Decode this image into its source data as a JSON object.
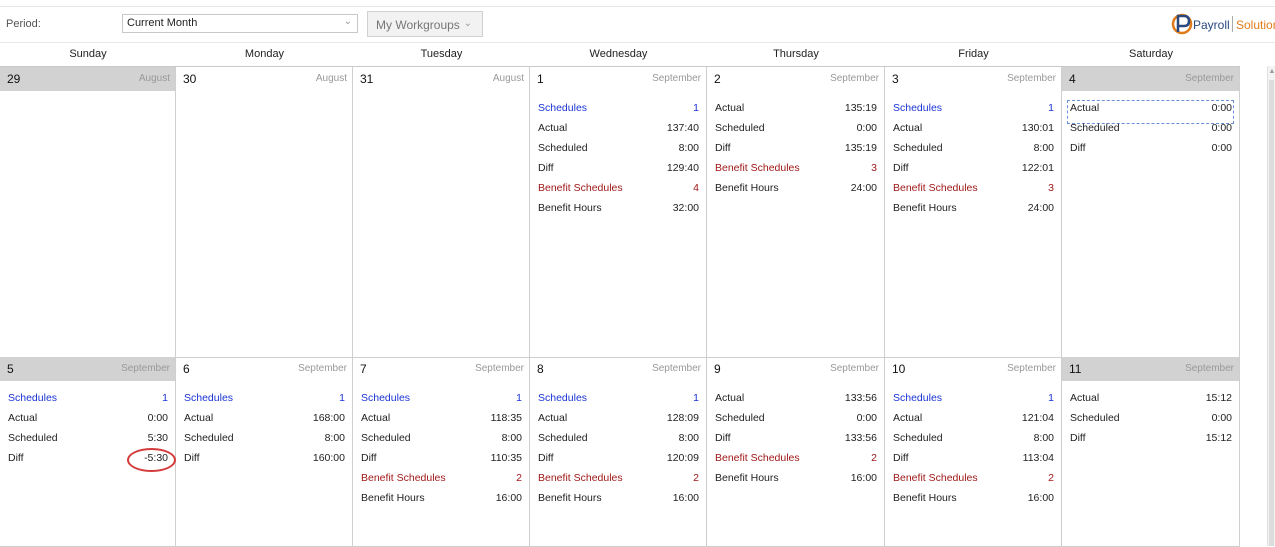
{
  "toolbar": {
    "period_label": "Period:",
    "period_value": "Current Month",
    "workgroups_label": "My Workgroups",
    "logo_text_a": "Payroll",
    "logo_text_b": "Solutions"
  },
  "weekdays": [
    "Sunday",
    "Monday",
    "Tuesday",
    "Wednesday",
    "Thursday",
    "Friday",
    "Saturday"
  ],
  "weeks": [
    {
      "days": [
        {
          "day": "29",
          "month": "August",
          "rows": []
        },
        {
          "day": "30",
          "month": "August",
          "rows": []
        },
        {
          "day": "31",
          "month": "August",
          "rows": []
        },
        {
          "day": "1",
          "month": "September",
          "rows": [
            {
              "label": "Schedules",
              "value": "1",
              "style": "blue"
            },
            {
              "label": "Actual",
              "value": "137:40"
            },
            {
              "label": "Scheduled",
              "value": "8:00"
            },
            {
              "label": "Diff",
              "value": "129:40"
            },
            {
              "label": "Benefit Schedules",
              "value": "4",
              "style": "red"
            },
            {
              "label": "Benefit Hours",
              "value": "32:00"
            }
          ]
        },
        {
          "day": "2",
          "month": "September",
          "rows": [
            {
              "label": "Actual",
              "value": "135:19"
            },
            {
              "label": "Scheduled",
              "value": "0:00"
            },
            {
              "label": "Diff",
              "value": "135:19"
            },
            {
              "label": "Benefit Schedules",
              "value": "3",
              "style": "red"
            },
            {
              "label": "Benefit Hours",
              "value": "24:00"
            }
          ]
        },
        {
          "day": "3",
          "month": "September",
          "rows": [
            {
              "label": "Schedules",
              "value": "1",
              "style": "blue"
            },
            {
              "label": "Actual",
              "value": "130:01"
            },
            {
              "label": "Scheduled",
              "value": "8:00"
            },
            {
              "label": "Diff",
              "value": "122:01"
            },
            {
              "label": "Benefit Schedules",
              "value": "3",
              "style": "red"
            },
            {
              "label": "Benefit Hours",
              "value": "24:00"
            }
          ]
        },
        {
          "day": "4",
          "month": "September",
          "rows": [
            {
              "label": "Actual",
              "value": "0:00"
            },
            {
              "label": "Scheduled",
              "value": "0:00"
            },
            {
              "label": "Diff",
              "value": "0:00"
            }
          ]
        }
      ]
    },
    {
      "days": [
        {
          "day": "5",
          "month": "September",
          "rows": [
            {
              "label": "Schedules",
              "value": "1",
              "style": "blue"
            },
            {
              "label": "Actual",
              "value": "0:00"
            },
            {
              "label": "Scheduled",
              "value": "5:30"
            },
            {
              "label": "Diff",
              "value": "-5:30"
            }
          ]
        },
        {
          "day": "6",
          "month": "September",
          "rows": [
            {
              "label": "Schedules",
              "value": "1",
              "style": "blue"
            },
            {
              "label": "Actual",
              "value": "168:00"
            },
            {
              "label": "Scheduled",
              "value": "8:00"
            },
            {
              "label": "Diff",
              "value": "160:00"
            }
          ]
        },
        {
          "day": "7",
          "month": "September",
          "rows": [
            {
              "label": "Schedules",
              "value": "1",
              "style": "blue"
            },
            {
              "label": "Actual",
              "value": "118:35"
            },
            {
              "label": "Scheduled",
              "value": "8:00"
            },
            {
              "label": "Diff",
              "value": "110:35"
            },
            {
              "label": "Benefit Schedules",
              "value": "2",
              "style": "red"
            },
            {
              "label": "Benefit Hours",
              "value": "16:00"
            }
          ]
        },
        {
          "day": "8",
          "month": "September",
          "rows": [
            {
              "label": "Schedules",
              "value": "1",
              "style": "blue"
            },
            {
              "label": "Actual",
              "value": "128:09"
            },
            {
              "label": "Scheduled",
              "value": "8:00"
            },
            {
              "label": "Diff",
              "value": "120:09"
            },
            {
              "label": "Benefit Schedules",
              "value": "2",
              "style": "red"
            },
            {
              "label": "Benefit Hours",
              "value": "16:00"
            }
          ]
        },
        {
          "day": "9",
          "month": "September",
          "rows": [
            {
              "label": "Actual",
              "value": "133:56"
            },
            {
              "label": "Scheduled",
              "value": "0:00"
            },
            {
              "label": "Diff",
              "value": "133:56"
            },
            {
              "label": "Benefit Schedules",
              "value": "2",
              "style": "red"
            },
            {
              "label": "Benefit Hours",
              "value": "16:00"
            }
          ]
        },
        {
          "day": "10",
          "month": "September",
          "rows": [
            {
              "label": "Schedules",
              "value": "1",
              "style": "blue"
            },
            {
              "label": "Actual",
              "value": "121:04"
            },
            {
              "label": "Scheduled",
              "value": "8:00"
            },
            {
              "label": "Diff",
              "value": "113:04"
            },
            {
              "label": "Benefit Schedules",
              "value": "2",
              "style": "red"
            },
            {
              "label": "Benefit Hours",
              "value": "16:00"
            }
          ]
        },
        {
          "day": "11",
          "month": "September",
          "rows": [
            {
              "label": "Actual",
              "value": "15:12"
            },
            {
              "label": "Scheduled",
              "value": "0:00"
            },
            {
              "label": "Diff",
              "value": "15:12"
            }
          ]
        }
      ]
    }
  ]
}
